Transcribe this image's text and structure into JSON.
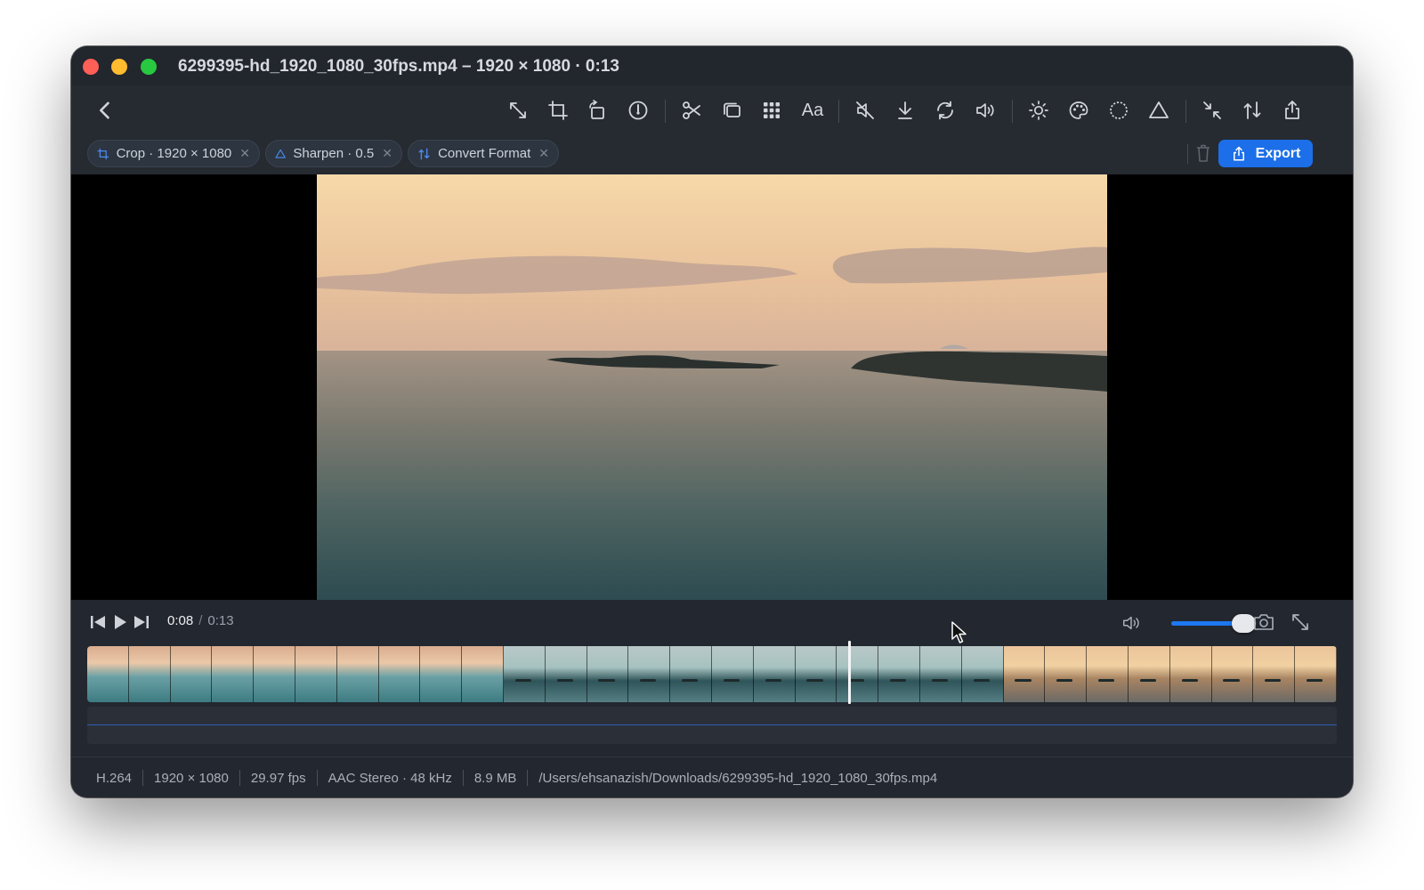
{
  "window": {
    "title": "6299395-hd_1920_1080_30fps.mp4 – 1920 × 1080 · 0:13"
  },
  "toolbar": {
    "tools": [
      {
        "name": "resize",
        "icon": "resize-icon"
      },
      {
        "name": "crop",
        "icon": "crop-icon"
      },
      {
        "name": "rotate",
        "icon": "rotate-icon"
      },
      {
        "name": "speed",
        "icon": "speedometer-icon"
      },
      {
        "name": "trim",
        "icon": "scissors-icon"
      },
      {
        "name": "merge",
        "icon": "layers-icon"
      },
      {
        "name": "grid",
        "icon": "grid-icon"
      },
      {
        "name": "text",
        "icon": "text-icon",
        "label": "Aa"
      },
      {
        "name": "mute",
        "icon": "mute-icon"
      },
      {
        "name": "extract-audio",
        "icon": "download-icon"
      },
      {
        "name": "loop",
        "icon": "loop-icon"
      },
      {
        "name": "volume",
        "icon": "volume-icon"
      },
      {
        "name": "brightness",
        "icon": "sun-icon"
      },
      {
        "name": "color",
        "icon": "palette-icon"
      },
      {
        "name": "vignette",
        "icon": "circle-icon"
      },
      {
        "name": "sharpen",
        "icon": "triangle-icon"
      },
      {
        "name": "compress",
        "icon": "compress-icon"
      },
      {
        "name": "convert",
        "icon": "convert-icon"
      },
      {
        "name": "share",
        "icon": "share-icon"
      }
    ]
  },
  "filters": [
    {
      "label": "Crop · 1920 × 1080",
      "icon": "crop-icon"
    },
    {
      "label": "Sharpen · 0.5",
      "icon": "triangle-icon"
    },
    {
      "label": "Convert Format",
      "icon": "convert-icon"
    }
  ],
  "export": {
    "label": "Export"
  },
  "playback": {
    "current": "0:08",
    "separator": "/",
    "total": "0:13",
    "volume_level": 0.85,
    "playhead_fraction": 0.61
  },
  "status": {
    "items": [
      "H.264",
      "1920 × 1080",
      "29.97 fps",
      "AAC Stereo · 48 kHz",
      "8.9 MB",
      "/Users/ehsanazish/Downloads/6299395-hd_1920_1080_30fps.mp4"
    ]
  },
  "colors": {
    "accent": "#1c6fe8",
    "window_bg": "#23272f",
    "chip_bg": "#2d3540"
  }
}
